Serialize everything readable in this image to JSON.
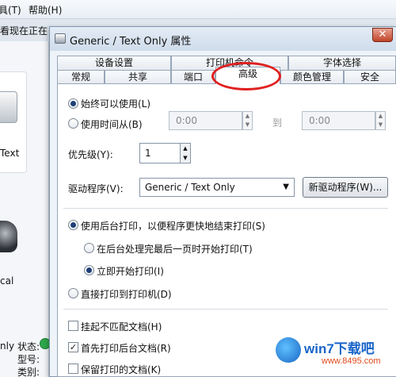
{
  "background": {
    "menu": [
      "工具(T)",
      "帮助(H)"
    ],
    "status_text": "看现在正在",
    "printer_label": "Text",
    "fax_label": "cal",
    "bottom_labels": [
      "nly",
      "状态:",
      "型号:",
      "类别:"
    ]
  },
  "dialog": {
    "title": "Generic / Text Only 属性",
    "close_label": "✕",
    "tabs_row1": [
      "设备设置",
      "打印机命令",
      "字体选择"
    ],
    "tabs_row2": [
      "常规",
      "共享",
      "端口",
      "高级",
      "颜色管理",
      "安全"
    ],
    "active_tab": "高级",
    "availability": {
      "always": "始终可以使用(L)",
      "from": "使用时间从(B)",
      "start_time": "0:00",
      "to": "到",
      "end_time": "0:00"
    },
    "priority": {
      "label": "优先级(Y):",
      "value": "1"
    },
    "driver": {
      "label": "驱动程序(V):",
      "selected": "Generic / Text Only",
      "new_driver_button": "新驱动程序(W)..."
    },
    "spooling": {
      "spool": "使用后台打印，以便程序更快地结束打印(S)",
      "after_last_page": "在后台处理完最后一页时开始打印(T)",
      "immediately": "立即开始打印(I)",
      "direct": "直接打印到打印机(D)"
    },
    "options": [
      {
        "label": "挂起不匹配文档(H)",
        "checked": false
      },
      {
        "label": "首先打印后台文档(R)",
        "checked": true
      },
      {
        "label": "保留打印的文档(K)",
        "checked": false
      }
    ]
  },
  "watermark": {
    "brand": "win7下载吧",
    "url": "www.8495.com"
  }
}
